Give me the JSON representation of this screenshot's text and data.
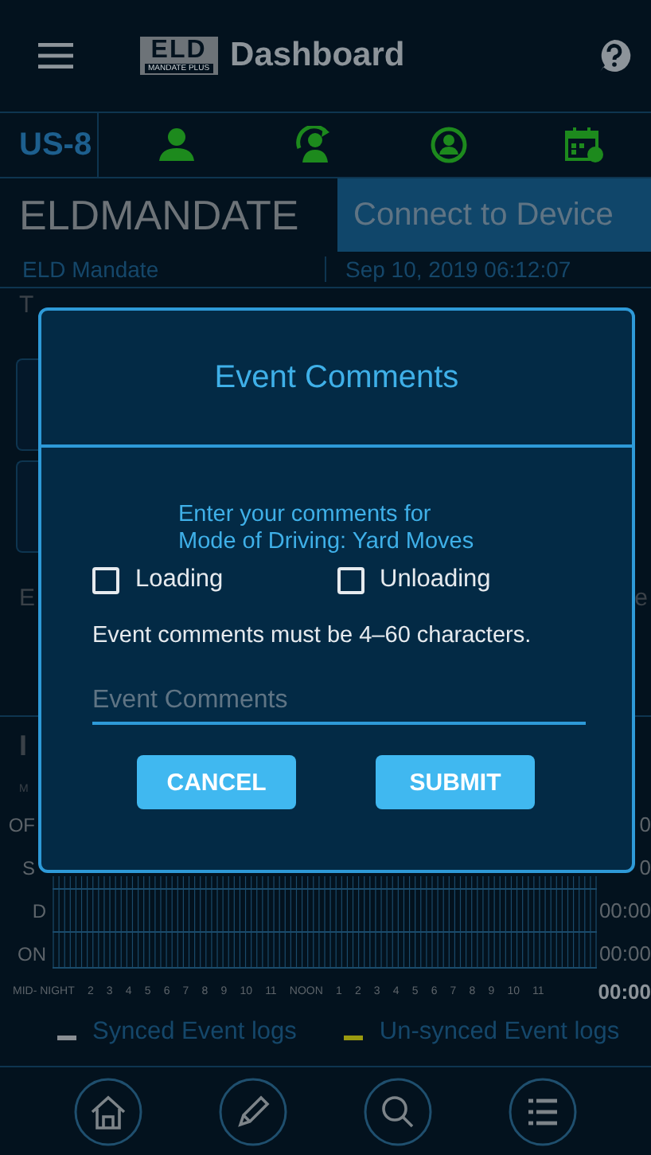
{
  "app_bar": {
    "logo_text": "ELD",
    "logo_subtext": "MANDATE PLUS",
    "title": "Dashboard"
  },
  "status_row": {
    "cycle": "US-8"
  },
  "driver": {
    "company": "ELDMANDATE",
    "connect_button": "Connect to Device",
    "name": "ELD Mandate",
    "datetime": "Sep 10, 2019 06:12:07"
  },
  "background_fragments": {
    "top_left": "T",
    "middle_left": "E",
    "middle_right": "e",
    "lower_left": "I",
    "tiny_left": "M"
  },
  "log_grid": {
    "rows": [
      {
        "label": "OF",
        "total": "0"
      },
      {
        "label": "S",
        "total": "0"
      },
      {
        "label": "D",
        "total": "00:00"
      },
      {
        "label": "ON",
        "total": "00:00"
      }
    ],
    "hours": [
      "MID- NIGHT",
      "2",
      "3",
      "4",
      "5",
      "6",
      "7",
      "8",
      "9",
      "10",
      "11",
      "NOON",
      "1",
      "2",
      "3",
      "4",
      "5",
      "6",
      "7",
      "8",
      "9",
      "10",
      "11"
    ],
    "grand_total": "00:00"
  },
  "legend": [
    {
      "label": "Synced Event logs",
      "color": "#8a8f94"
    },
    {
      "label": "Un-synced Event logs",
      "color": "#9a9a10"
    }
  ],
  "dialog": {
    "title": "Event Comments",
    "prompt": "Enter your comments for\nMode of Driving: Yard Moves",
    "options": [
      {
        "label": "Loading",
        "checked": false
      },
      {
        "label": "Unloading",
        "checked": false
      }
    ],
    "hint": "Event comments must be 4–60 characters.",
    "input": {
      "placeholder": "Event Comments"
    },
    "buttons": [
      "CANCEL",
      "SUBMIT"
    ]
  }
}
